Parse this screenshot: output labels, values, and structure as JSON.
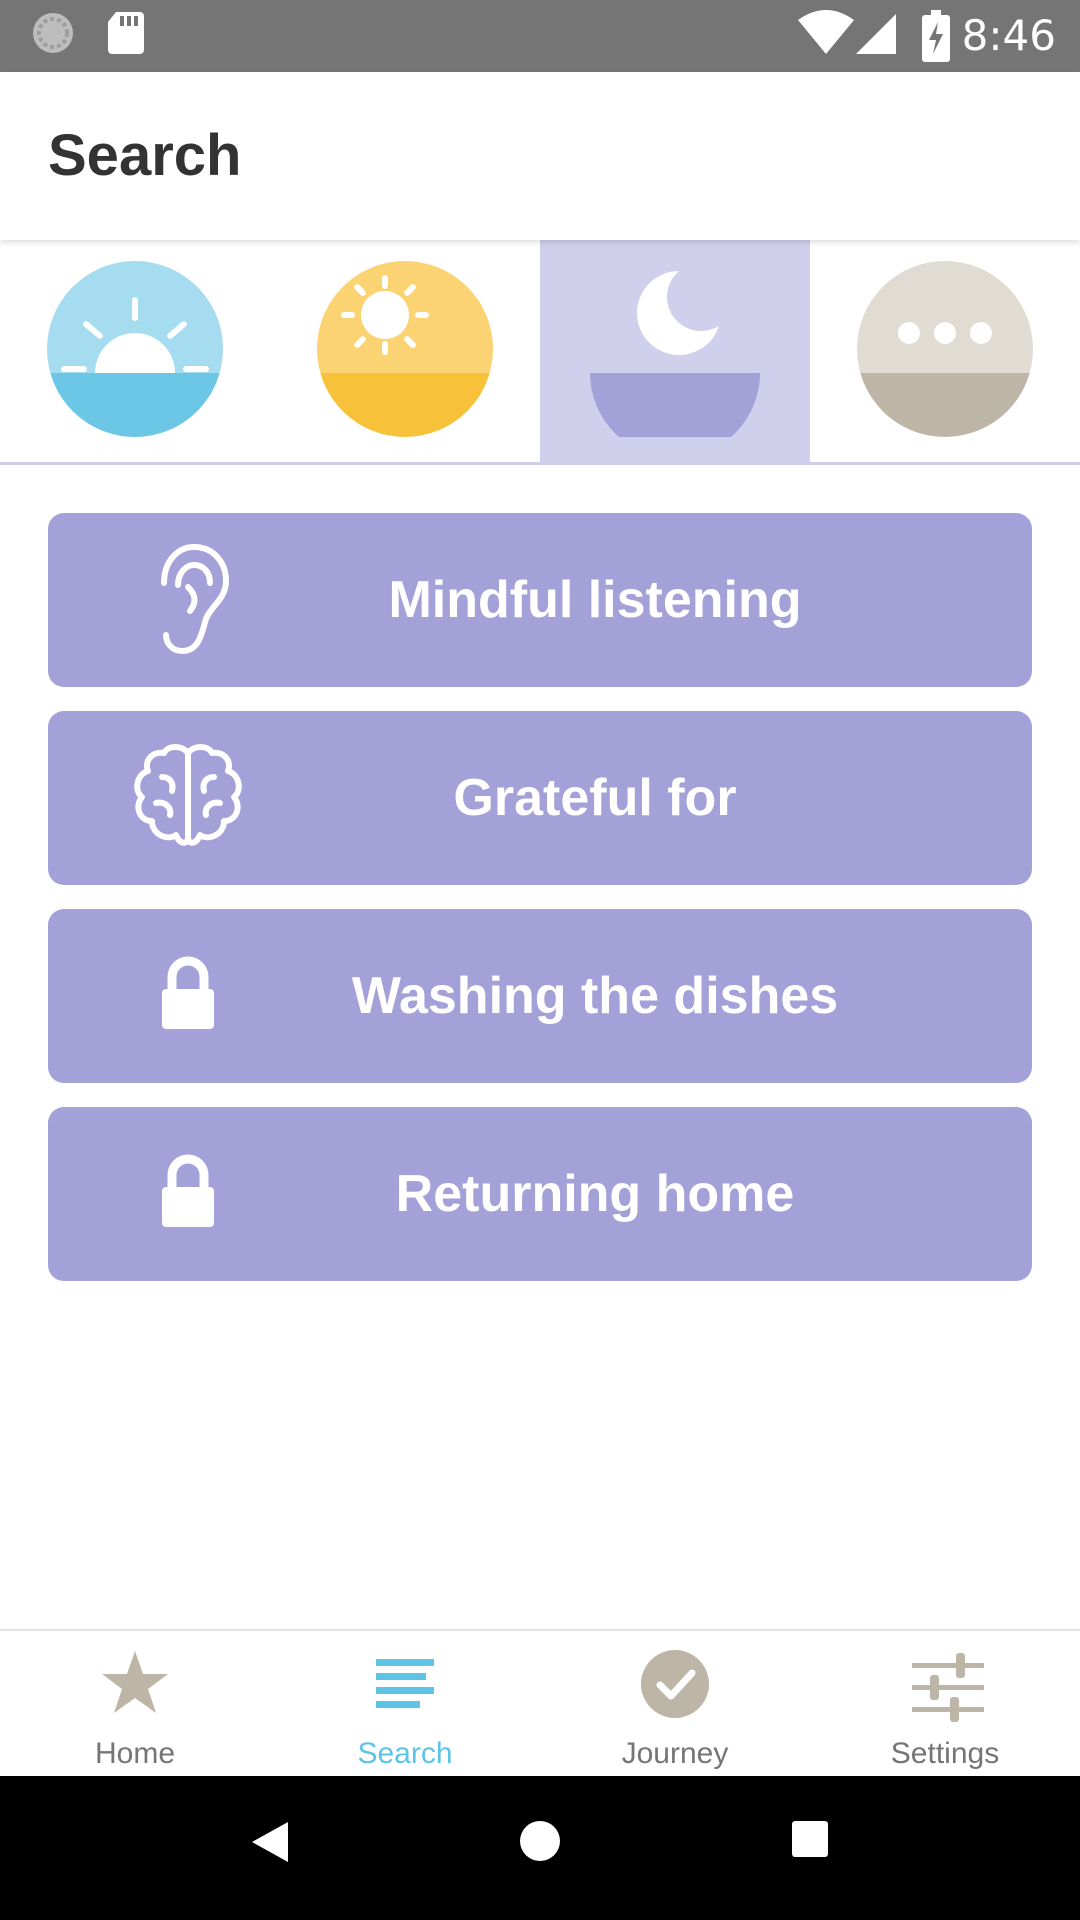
{
  "status_bar": {
    "time": "8:46",
    "left_icons": [
      "sync-icon",
      "sd-card-icon"
    ],
    "right_icons": [
      "wifi-icon",
      "cell-signal-icon",
      "battery-charging-icon"
    ]
  },
  "header": {
    "title": "Search"
  },
  "categories": [
    {
      "name": "morning",
      "icon": "sunrise-icon",
      "color": "#6dc6e6",
      "selected": false
    },
    {
      "name": "daytime",
      "icon": "sun-icon",
      "color": "#f8c13a",
      "selected": false
    },
    {
      "name": "evening",
      "icon": "moon-icon",
      "color": "#a3a1d8",
      "selected": true
    },
    {
      "name": "other",
      "icon": "more-icon",
      "color": "#bdb5a6",
      "selected": false
    }
  ],
  "sessions": [
    {
      "label": "Mindful listening",
      "icon": "ear-icon",
      "locked": false
    },
    {
      "label": "Grateful for",
      "icon": "brain-icon",
      "locked": false
    },
    {
      "label": "Washing the dishes",
      "icon": "lock-icon",
      "locked": true
    },
    {
      "label": "Returning home",
      "icon": "lock-icon",
      "locked": true
    }
  ],
  "bottom_nav": [
    {
      "label": "Home",
      "icon": "star-icon",
      "active": false
    },
    {
      "label": "Search",
      "icon": "list-icon",
      "active": true
    },
    {
      "label": "Journey",
      "icon": "check-circle-icon",
      "active": false
    },
    {
      "label": "Settings",
      "icon": "sliders-icon",
      "active": false
    }
  ],
  "colors": {
    "accent": "#5ec4e6",
    "card": "#a3a1d8",
    "selected_category_bg": "#d0cfec",
    "nav_icon": "#bdb5a6",
    "status_bar": "#757575"
  }
}
